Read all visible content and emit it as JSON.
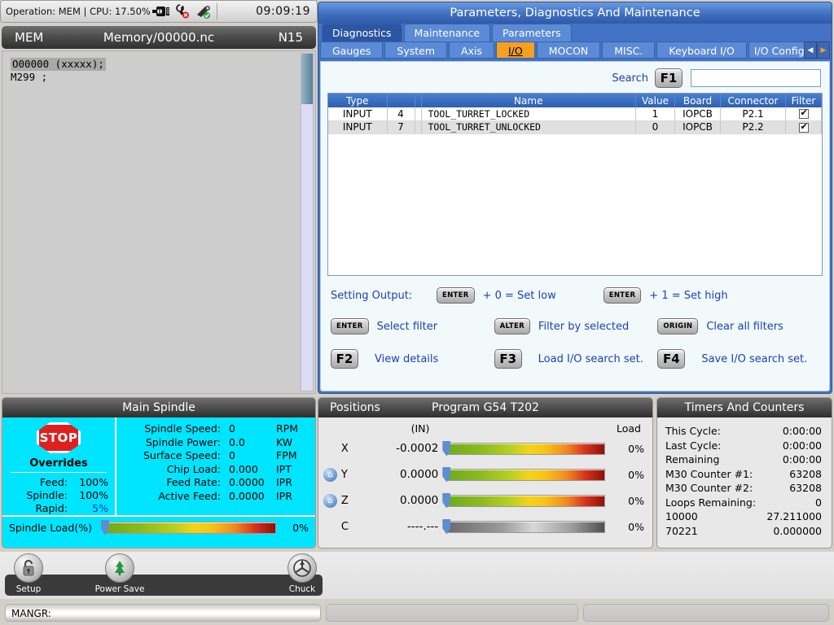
{
  "topbar": {
    "operation_text": "Operation: MEM | CPU: 17.50%",
    "clock": "09:09:19",
    "icons": [
      "plug-connector-icon",
      "tool-error-icon",
      "tool-ok-icon"
    ]
  },
  "program_header": {
    "mode": "MEM",
    "file": "Memory/00000.nc",
    "sequence": "N15"
  },
  "program": {
    "lines": [
      "O00000 (xxxxx);",
      "M299 ;"
    ]
  },
  "main_panel": {
    "title": "Parameters, Diagnostics And Maintenance",
    "primary_tabs": [
      {
        "label": "Diagnostics",
        "active": true
      },
      {
        "label": "Maintenance",
        "active": false
      },
      {
        "label": "Parameters",
        "active": false
      }
    ],
    "secondary_tabs": [
      {
        "label": "Gauges",
        "active": false
      },
      {
        "label": "System",
        "active": false
      },
      {
        "label": "Axis",
        "active": false
      },
      {
        "label": "I/O",
        "active": true
      },
      {
        "label": "MOCON",
        "active": false
      },
      {
        "label": "MISC.",
        "active": false
      },
      {
        "label": "Keyboard I/O",
        "active": false
      },
      {
        "label": "I/O Config",
        "active": false
      }
    ],
    "tab_scroll": {
      "prev": "◀",
      "next": "▶"
    }
  },
  "search": {
    "label": "Search",
    "key": "F1",
    "value": "",
    "placeholder": ""
  },
  "table": {
    "columns": [
      "Type",
      "",
      "",
      "Name",
      "Value",
      "Board",
      "Connector",
      "Filter"
    ],
    "rows": [
      {
        "type": "INPUT",
        "index": "4",
        "name": "TOOL_TURRET_LOCKED",
        "value": "1",
        "board": "IOPCB",
        "connector": "P2.1",
        "filter": true
      },
      {
        "type": "INPUT",
        "index": "7",
        "name": "TOOL_TURRET_UNLOCKED",
        "value": "0",
        "board": "IOPCB",
        "connector": "P2.2",
        "filter": true
      }
    ]
  },
  "legend": {
    "setting_output_label": "Setting Output:",
    "set_low_key": "ENTER",
    "set_low_text": "+ 0 = Set low",
    "set_high_key": "ENTER",
    "set_high_text": "+ 1 = Set high",
    "items": [
      {
        "key": "ENTER",
        "text": "Select filter"
      },
      {
        "key": "ALTER",
        "text": "Filter by selected"
      },
      {
        "key": "ORIGIN",
        "text": "Clear all filters"
      },
      {
        "key": "F2",
        "text": "View details"
      },
      {
        "key": "F3",
        "text": "Load I/O search set."
      },
      {
        "key": "F4",
        "text": "Save I/O search set."
      }
    ]
  },
  "spindle": {
    "title": "Main Spindle",
    "stop_label": "STOP",
    "overrides_title": "Overrides",
    "overrides": [
      {
        "label": "Feed:",
        "value": "100%",
        "highlight": false
      },
      {
        "label": "Spindle:",
        "value": "100%",
        "highlight": false
      },
      {
        "label": "Rapid:",
        "value": "5%",
        "highlight": true
      }
    ],
    "readouts": [
      {
        "label": "Spindle Speed:",
        "value": "0",
        "unit": "RPM"
      },
      {
        "label": "Spindle Power:",
        "value": "0.0",
        "unit": "KW"
      },
      {
        "label": "Surface Speed:",
        "value": "0",
        "unit": "FPM"
      },
      {
        "label": "Chip Load:",
        "value": "0.000",
        "unit": "IPT"
      },
      {
        "label": "Feed Rate:",
        "value": "0.0000",
        "unit": "IPR"
      },
      {
        "label": "Active Feed:",
        "value": "0.0000",
        "unit": "IPR"
      }
    ],
    "load_label": "Spindle Load(%)",
    "load_pct": "0%"
  },
  "positions": {
    "title": "Positions",
    "program_label": "Program G54 T202",
    "units_header": "(IN)",
    "load_header": "Load",
    "axes": [
      {
        "axis": "X",
        "value": "-0.0002",
        "load": "0%",
        "homed": false,
        "inactive": false
      },
      {
        "axis": "Y",
        "value": "0.0000",
        "load": "0%",
        "homed": true,
        "inactive": false
      },
      {
        "axis": "Z",
        "value": "0.0000",
        "load": "0%",
        "homed": true,
        "inactive": false
      },
      {
        "axis": "C",
        "value": "----.---",
        "load": "0%",
        "homed": false,
        "inactive": true
      }
    ]
  },
  "timers": {
    "title": "Timers And Counters",
    "rows": [
      {
        "label": "This Cycle:",
        "value": "0:00:00"
      },
      {
        "label": "Last Cycle:",
        "value": "0:00:00"
      },
      {
        "label": "Remaining",
        "value": "0:00:00"
      },
      {
        "label": "M30 Counter #1:",
        "value": "63208"
      },
      {
        "label": "M30 Counter #2:",
        "value": "63208"
      },
      {
        "label": "Loops Remaining:",
        "value": "0"
      },
      {
        "label": "10000",
        "value": "27.211000"
      },
      {
        "label": "70221",
        "value": "0.000000"
      }
    ]
  },
  "toolbar": {
    "items": [
      {
        "label": "Setup",
        "icon": "padlock-icon"
      },
      {
        "label": "Power Save",
        "icon": "tree-icon"
      },
      {
        "label": "Chuck",
        "icon": "chuck-icon"
      }
    ]
  },
  "statusbar": {
    "message": "MANGR:"
  },
  "colors": {
    "accent_blue": "#1c3fb5",
    "active_tab_orange": "#f5a01e",
    "panel_blue": "#4472c4",
    "spindle_cyan": "#00e5ff",
    "stop_red": "#e02020"
  }
}
